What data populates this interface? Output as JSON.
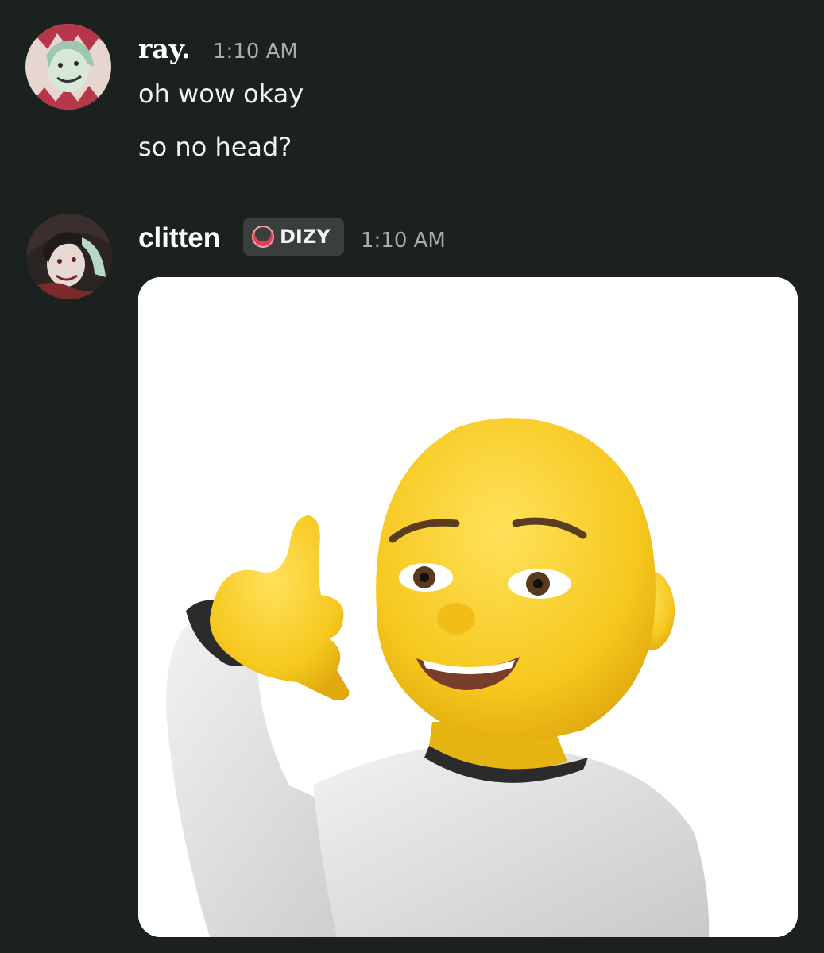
{
  "messages": [
    {
      "author": "ray.",
      "timestamp": "1:10 AM",
      "lines": [
        "oh wow okay",
        "so no head?"
      ],
      "avatar_icon": "anime-avatar-icon"
    },
    {
      "author": "clitten",
      "timestamp": "1:10 AM",
      "tag": {
        "label": "DIZY",
        "icon": "crescent-tag-icon",
        "color": "#e0404f"
      },
      "attachment": {
        "kind": "image",
        "subject": "memoji-call-me-gesture"
      },
      "avatar_icon": "anime-avatar-icon"
    }
  ],
  "colors": {
    "background": "#1a211f",
    "text": "#f2f3f3",
    "muted": "#a7aead",
    "tag_bg": "#3a3f3e"
  }
}
